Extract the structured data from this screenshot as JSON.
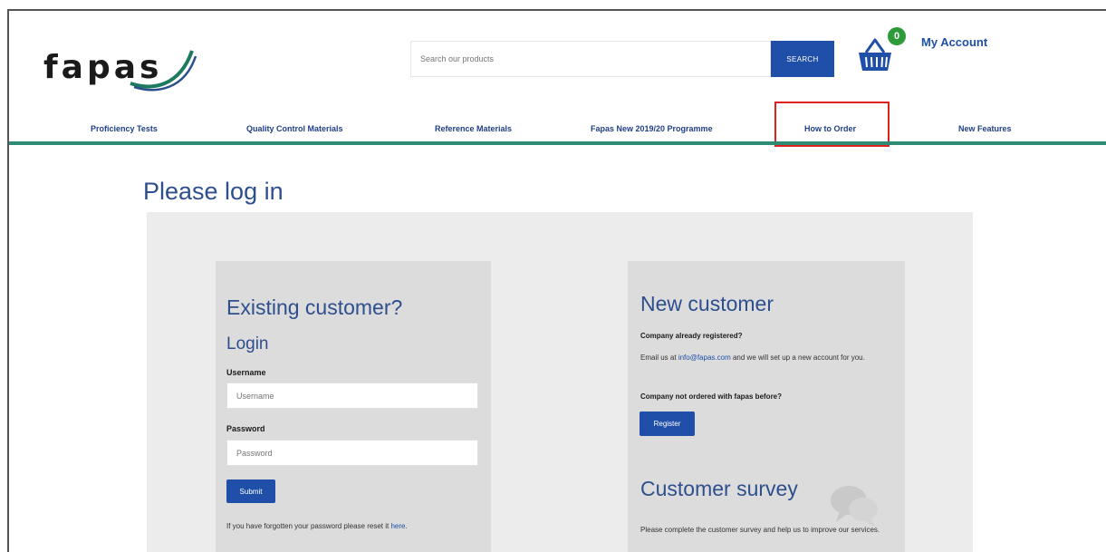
{
  "header": {
    "logo_text": "fapas",
    "search_placeholder": "Search our products",
    "search_button": "SEARCH",
    "basket_count": "0",
    "my_account": "My Account"
  },
  "nav": {
    "items": [
      {
        "label": "Proficiency Tests"
      },
      {
        "label": "Quality Control Materials"
      },
      {
        "label": "Reference Materials"
      },
      {
        "label": "Fapas New 2019/20 Programme"
      },
      {
        "label": "How to Order"
      },
      {
        "label": "New Features"
      }
    ],
    "highlight_color": "#e0201c",
    "rule_color": "#2f8b73"
  },
  "page": {
    "title": "Please log in"
  },
  "existing": {
    "heading": "Existing customer?",
    "subheading": "Login",
    "username_label": "Username",
    "username_placeholder": "Username",
    "password_label": "Password",
    "password_placeholder": "Password",
    "submit_button": "Submit",
    "forgot_text": "If you have forgotten your password please reset it",
    "forgot_link": "here."
  },
  "new_customer": {
    "heading": "New customer",
    "registered_question": "Company already registered?",
    "email_prefix": "Email us at",
    "email_link": "info@fapas.com",
    "email_suffix": "and we will set up a new account for you.",
    "not_ordered_question": "Company not ordered with fapas before?",
    "register_button": "Register"
  },
  "survey": {
    "heading": "Customer survey",
    "text": "Please complete the customer survey and help us to improve our services.",
    "icon": "chat-bubble-icon"
  },
  "colors": {
    "brand_blue": "#1f4fa8",
    "heading_blue": "#2d4f8e",
    "badge_green": "#2e9b3a"
  }
}
